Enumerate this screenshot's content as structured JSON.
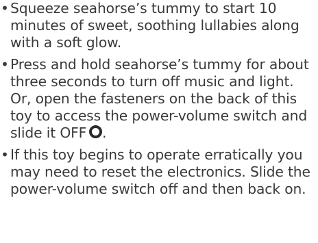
{
  "bullet_symbol": "•",
  "instructions": [
    {
      "text": "Squeeze seahorse’s tummy to start 10 minutes of sweet, soothing lullabies along with a soft glow."
    },
    {
      "text": "Press and hold seahorse’s tummy for about three seconds to turn off music and light. Or, open the fasteners on the back of this toy to access the power-volume switch and slide it OFF",
      "trailing_icon": "power-off-circle-icon"
    },
    {
      "text": "If this toy begins to operate erratically you may need to reset the electronics. Slide the power-volume switch off and then back on."
    }
  ],
  "colors": {
    "text": "#3a3a3c",
    "icon": "#2a2a2c",
    "background": "#ffffff"
  }
}
